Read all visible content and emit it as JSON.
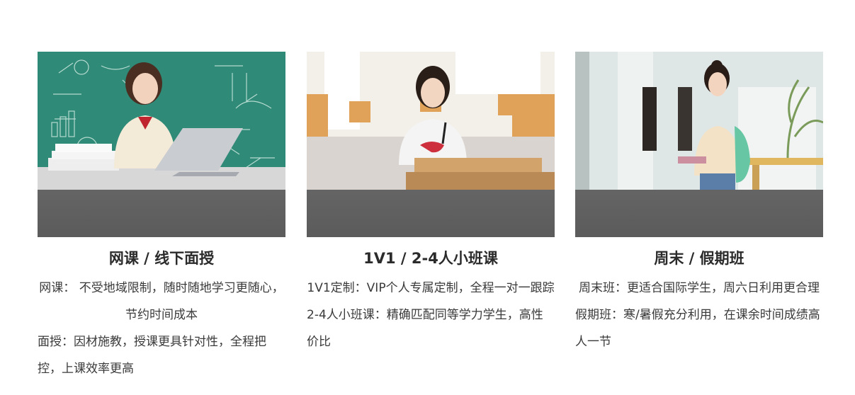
{
  "cards": [
    {
      "title": "网课 / 线下面授",
      "para1": "网课： 不受地域限制，随时随地学习更随心，节约时间成本",
      "para2": "面授：因材施教，授课更具针对性，全程把控，上课效率更高"
    },
    {
      "title": "1V1 / 2-4人小班课",
      "para1": "1V1定制：VIP个人专属定制，全程一对一跟踪",
      "para2": "2-4人小班课：精确匹配同等学力学生，高性价比"
    },
    {
      "title": "周末 / 假期班",
      "para1": "周末班：更适合国际学生，周六日利用更合理",
      "para2": "假期班：寒/暑假充分利用，在课余时间成绩高人一节"
    }
  ],
  "colors": {
    "chalkboard": "#2f8a77",
    "classroom_wall": "#f3efe9",
    "desk_wood": "#d9a25b",
    "hallway": "#dfe7e6",
    "photo_fade": "#5b5b5b"
  }
}
